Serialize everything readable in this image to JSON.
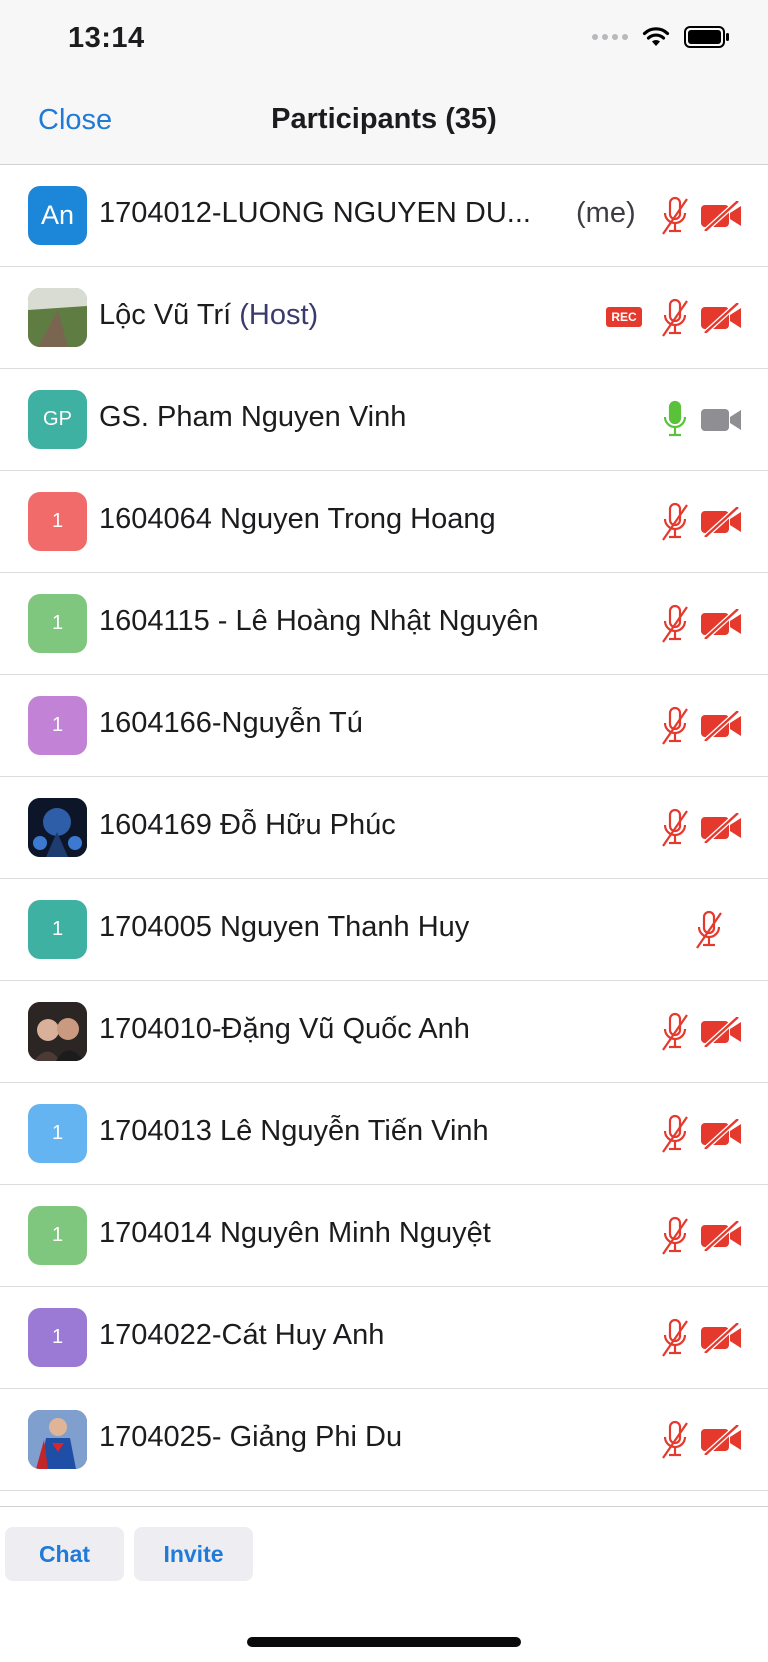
{
  "status_bar": {
    "time": "13:14"
  },
  "nav": {
    "close_label": "Close",
    "title": "Participants (35)"
  },
  "participants": [
    {
      "initials": "An",
      "name": "1704012-LUONG NGUYEN DU...",
      "me": "(me)",
      "avatar_color": "#1c86d9",
      "mic": "muted",
      "video": "off"
    },
    {
      "initials": "",
      "name": "Lộc Vũ Trí",
      "host": "(Host)",
      "rec": "REC",
      "avatar_color": "#6a8a50",
      "avatar_type": "photo-landscape",
      "mic": "muted",
      "video": "off"
    },
    {
      "initials": "GP",
      "name": "GS. Pham Nguyen Vinh",
      "avatar_color": "#3fb1a3",
      "mic": "on",
      "video": "off-gray"
    },
    {
      "initials": "1",
      "name": "1604064 Nguyen Trong Hoang",
      "avatar_color": "#f26b6b",
      "mic": "muted",
      "video": "off"
    },
    {
      "initials": "1",
      "name": "1604115 - Lê Hoàng Nhật Nguyên",
      "avatar_color": "#7fc77e",
      "mic": "muted",
      "video": "off"
    },
    {
      "initials": "1",
      "name": "1604166-Nguyễn Tú",
      "avatar_color": "#c283d6",
      "mic": "muted",
      "video": "off"
    },
    {
      "initials": "",
      "name": "1604169 Đỗ Hữu Phúc",
      "avatar_color": "#1d2a4a",
      "avatar_type": "photo-dark",
      "mic": "muted",
      "video": "off"
    },
    {
      "initials": "1",
      "name": "1704005 Nguyen Thanh Huy",
      "avatar_color": "#3fb1a3",
      "mic": "muted",
      "video": "none"
    },
    {
      "initials": "",
      "name": "1704010-Đặng Vũ Quốc Anh",
      "avatar_color": "#3a2e2a",
      "avatar_type": "photo-people",
      "mic": "muted",
      "video": "off"
    },
    {
      "initials": "1",
      "name": "1704013 Lê Nguyễn Tiến Vinh",
      "avatar_color": "#63b4f0",
      "mic": "muted",
      "video": "off"
    },
    {
      "initials": "1",
      "name": "1704014 Nguyên Minh Nguyệt",
      "avatar_color": "#7fc77e",
      "mic": "muted",
      "video": "off"
    },
    {
      "initials": "1",
      "name": "1704022-Cát Huy Anh",
      "avatar_color": "#9a7ad4",
      "mic": "muted",
      "video": "off"
    },
    {
      "initials": "",
      "name": "1704025- Giảng Phi Du",
      "avatar_color": "#2d4f8f",
      "avatar_type": "photo-superman",
      "mic": "muted",
      "video": "off"
    }
  ],
  "footer": {
    "chat_label": "Chat",
    "invite_label": "Invite"
  },
  "colors": {
    "accent": "#1f7ad8",
    "muted_red": "#e5392d",
    "mic_on_green": "#5ac13a",
    "icon_gray": "#8e8e93"
  }
}
